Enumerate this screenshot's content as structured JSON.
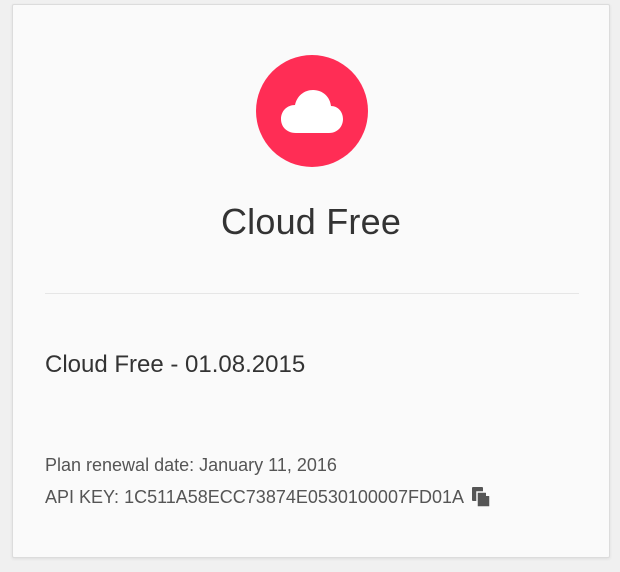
{
  "plan": {
    "icon": "cloud-icon",
    "icon_color": "#ff2d55",
    "title": "Cloud Free"
  },
  "subscription": {
    "name": "Cloud Free - 01.08.2015"
  },
  "details": {
    "renewal_label": "Plan renewal date:",
    "renewal_date": "January 11, 2016",
    "api_key_label": "API KEY:",
    "api_key": "1C511A58ECC73874E0530100007FD01A",
    "copy_icon": "copy-icon"
  }
}
